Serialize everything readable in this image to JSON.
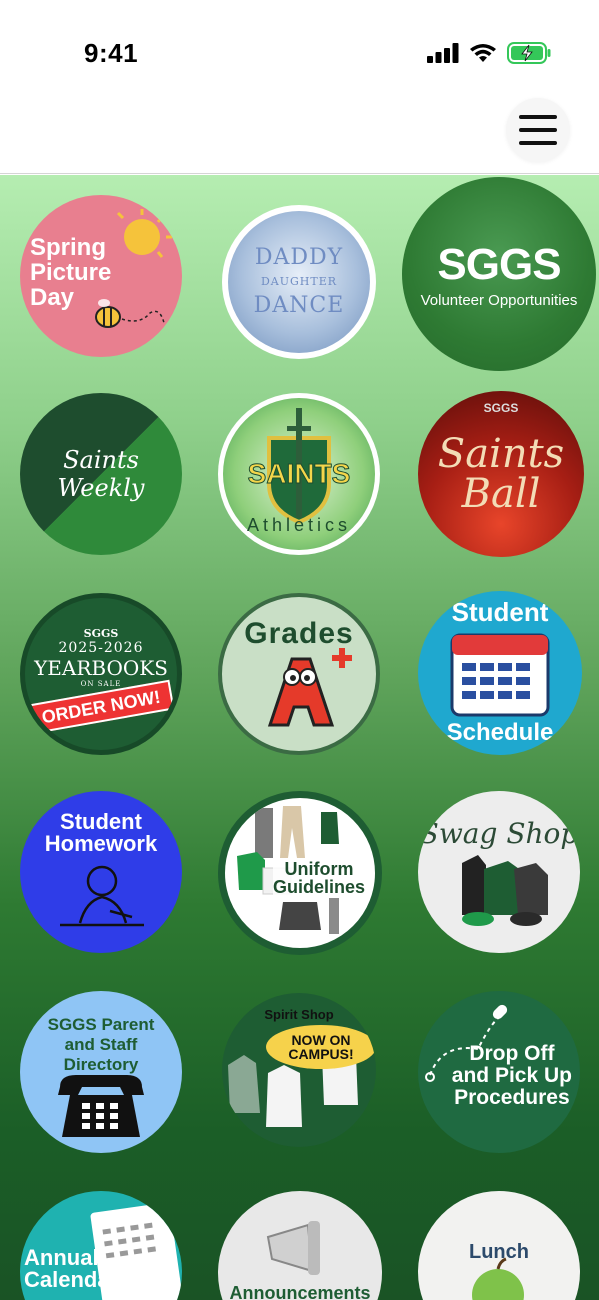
{
  "status_bar": {
    "time": "9:41"
  },
  "header": {
    "menu_icon": "hamburger-menu-icon"
  },
  "tiles": [
    {
      "id": "spring-picture-day",
      "label": "Spring Picture Day",
      "line1": "Spring",
      "line2": "Picture",
      "line3": "Day",
      "bg": "#e87f8f"
    },
    {
      "id": "daddy-daughter-dance",
      "label": "DADDY DAUGHTER DANCE",
      "line1": "DADDY",
      "line2": "DAUGHTER",
      "line3": "DANCE"
    },
    {
      "id": "sggs-volunteer",
      "label": "SGGS Volunteer Opportunities",
      "line1": "SGGS",
      "line2": "Volunteer Opportunities"
    },
    {
      "id": "saints-weekly",
      "label": "Saints Weekly"
    },
    {
      "id": "saints-athletics",
      "label": "SAINTS Athletics",
      "line1": "SAINTS",
      "line2": "Athletics"
    },
    {
      "id": "saints-ball",
      "label": "Saints Ball",
      "line1": "SGGS",
      "line2": "Saints Ball"
    },
    {
      "id": "yearbooks",
      "label": "SGGS 2025-2026 YEARBOOKS ON SALE ORDER NOW!",
      "line1": "SGGS",
      "line2": "2025-2026",
      "line3": "YEARBOOKS",
      "line4": "ON SALE",
      "line5": "ORDER NOW!"
    },
    {
      "id": "grades",
      "label": "Grades"
    },
    {
      "id": "student-schedule",
      "label": "Student Schedule",
      "line1": "Student",
      "line2": "Schedule"
    },
    {
      "id": "student-homework",
      "label": "Student Homework",
      "line1": "Student",
      "line2": "Homework"
    },
    {
      "id": "uniform-guidelines",
      "label": "Uniform Guidelines",
      "line1": "Uniform",
      "line2": "Guidelines"
    },
    {
      "id": "swag-shop",
      "label": "Swag Shop"
    },
    {
      "id": "directory",
      "label": "SGGS Parent and Staff Directory",
      "line1": "SGGS Parent",
      "line2": "and Staff",
      "line3": "Directory"
    },
    {
      "id": "spirit-shop",
      "label": "Spirit Shop",
      "badge": "NOW ON CAMPUS!"
    },
    {
      "id": "drop-off",
      "label": "Drop Off and Pick Up Procedures",
      "line1": "Drop Off",
      "line2": "and Pick Up",
      "line3": "Procedures"
    },
    {
      "id": "annual-calendar",
      "label": "Annual Calendar",
      "line1": "Annual",
      "line2": "Calendar"
    },
    {
      "id": "announcements",
      "label": "Announcements"
    },
    {
      "id": "lunch",
      "label": "Lunch"
    }
  ]
}
